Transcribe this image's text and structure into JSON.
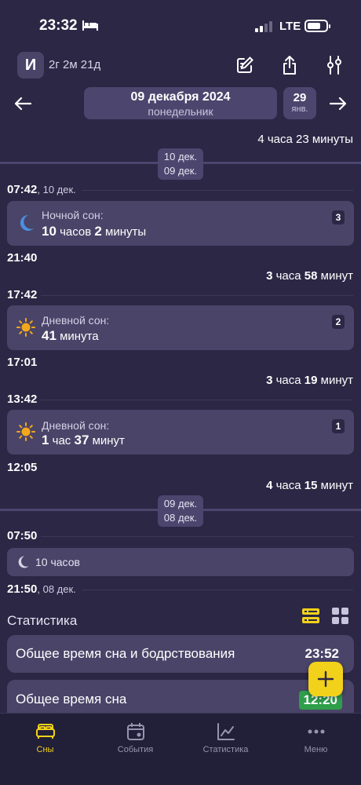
{
  "status_bar": {
    "time": "23:32",
    "network": "LTE"
  },
  "header": {
    "avatar_letter": "И",
    "age": "2г 2м 21д"
  },
  "date_nav": {
    "date": "09 декабря 2024",
    "weekday": "понедельник",
    "next_day": "29",
    "next_month": "янв."
  },
  "timeline": {
    "top_gap": {
      "num1": "4",
      "unit1": "часа",
      "num2": "23",
      "unit2": "минуты"
    },
    "divider1": {
      "line1": "10 дек.",
      "line2": "09 дек."
    },
    "wake1": {
      "time": "07:42",
      "date": ", 10 дек."
    },
    "night_card": {
      "title": "Ночной сон:",
      "n1": "10",
      "u1": "часов",
      "n2": "2",
      "u2": "минуты",
      "badge": "3"
    },
    "sleep1": {
      "time": "21:40"
    },
    "gap2": {
      "num1": "3",
      "unit1": "часа",
      "num2": "58",
      "unit2": "минут"
    },
    "wake2": {
      "time": "17:42"
    },
    "day_card1": {
      "title": "Дневной сон:",
      "n1": "41",
      "u1": "минута",
      "badge": "2"
    },
    "sleep2": {
      "time": "17:01"
    },
    "gap3": {
      "num1": "3",
      "unit1": "часа",
      "num2": "19",
      "unit2": "минут"
    },
    "wake3": {
      "time": "13:42"
    },
    "day_card2": {
      "title": "Дневной сон:",
      "n1": "1",
      "u1": "час",
      "n2": "37",
      "u2": "минут",
      "badge": "1"
    },
    "sleep3": {
      "time": "12:05"
    },
    "gap4": {
      "num1": "4",
      "unit1": "часа",
      "num2": "15",
      "unit2": "минут"
    },
    "divider2": {
      "line1": "09 дек.",
      "line2": "08 дек."
    },
    "wake4": {
      "time": "07:50"
    },
    "night_compact": {
      "label": "10 часов"
    },
    "sleep4": {
      "time": "21:50",
      "date": ", 08 дек."
    }
  },
  "stats": {
    "title": "Статистика",
    "rows": [
      {
        "label": "Общее время сна и бодрствования",
        "value": "23:52"
      },
      {
        "label": "Общее время сна",
        "value": "12:20"
      }
    ]
  },
  "tabs": [
    {
      "label": "Сны",
      "icon": "bed-icon",
      "active": true
    },
    {
      "label": "События",
      "icon": "calendar-icon",
      "active": false
    },
    {
      "label": "Статистика",
      "icon": "chart-icon",
      "active": false
    },
    {
      "label": "Меню",
      "icon": "more-icon",
      "active": false
    }
  ],
  "colors": {
    "background": "#2b2745",
    "card": "#4a4468",
    "accent": "#f2d11a",
    "moon": "#4a8fe0",
    "sun": "#f2a81c",
    "green": "#2e9e4a"
  }
}
